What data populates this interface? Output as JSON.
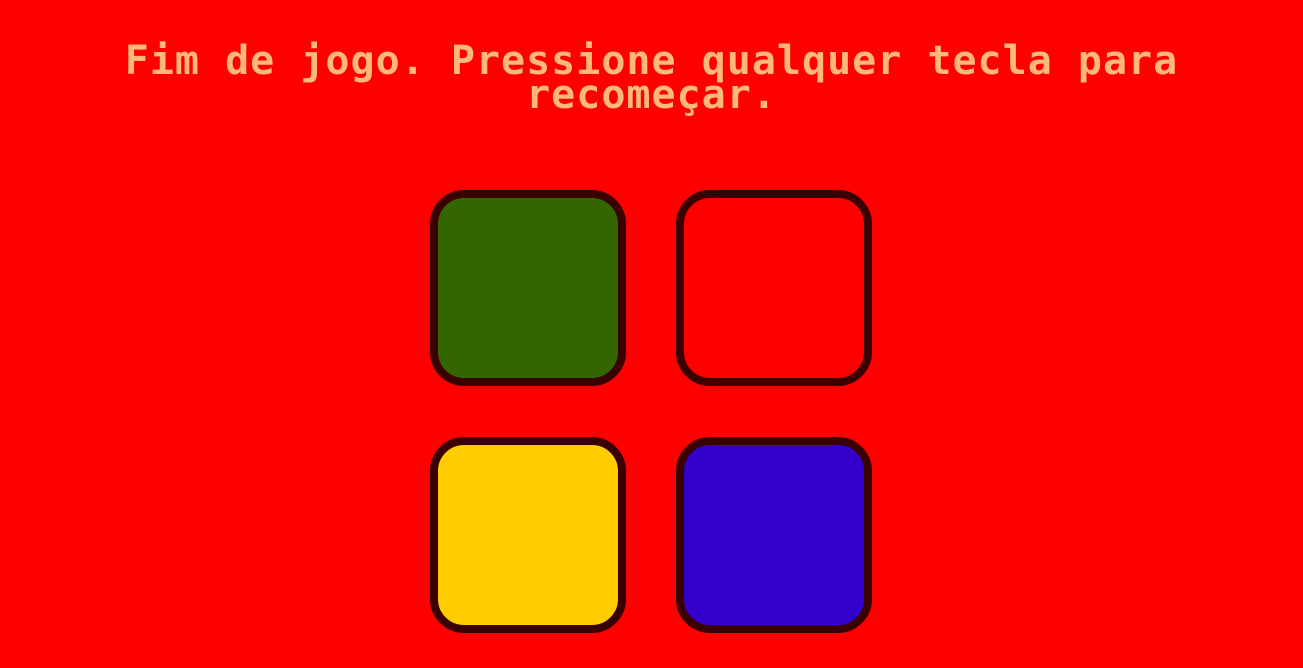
{
  "game": {
    "status_message": "Fim de jogo. Pressione qualquer tecla para recomeçar.",
    "state": "game-over"
  },
  "colors": {
    "background": "#ff0000",
    "message_text": "#fdb87a",
    "pad_border": "#3a0000"
  },
  "pads": [
    {
      "id": "green",
      "color": "#336600"
    },
    {
      "id": "red",
      "color": "#ff0000"
    },
    {
      "id": "yellow",
      "color": "#ffcc00"
    },
    {
      "id": "blue",
      "color": "#3300cc"
    }
  ]
}
